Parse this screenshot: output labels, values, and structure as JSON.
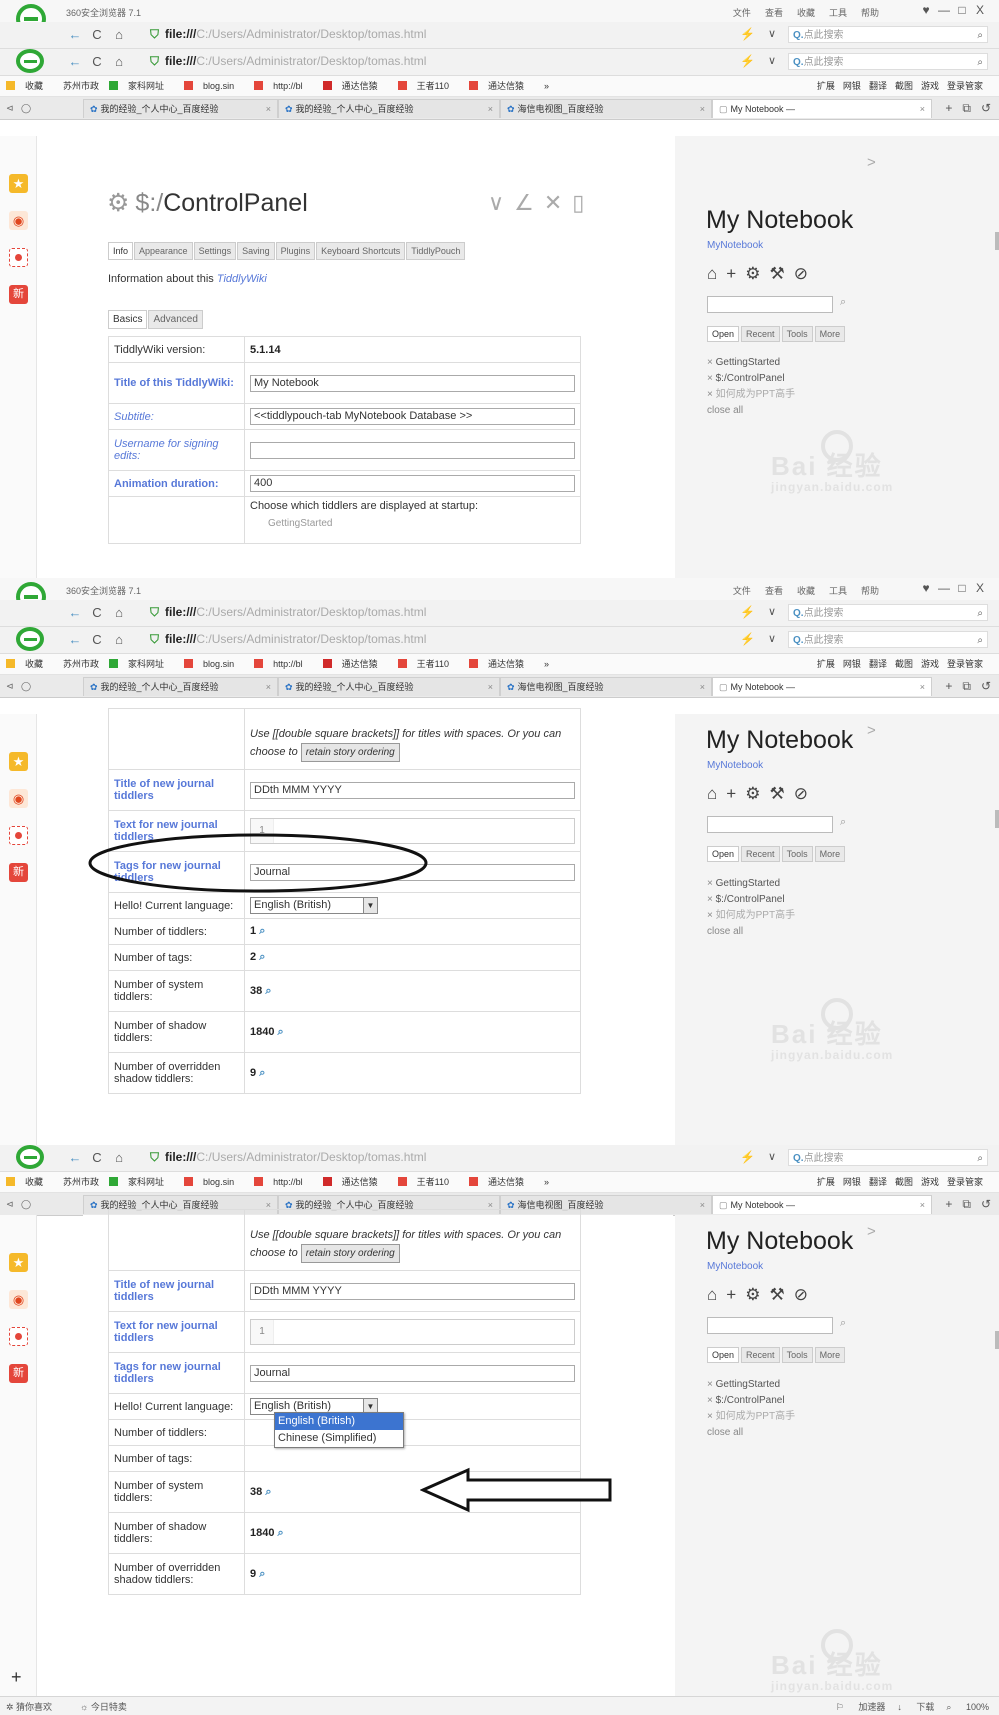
{
  "browser": {
    "app_title": "360安全浏览器 7.1",
    "menus": [
      "文件",
      "查看",
      "收藏",
      "工具",
      "帮助"
    ],
    "window_controls": [
      "♥",
      "—",
      "□",
      "X"
    ],
    "address_scheme": "file:///",
    "address_path": "C:/Users/Administrator/Desktop/tomas.html",
    "search_placeholder": "点此搜索",
    "bookmarks": [
      "收藏",
      "苏州市政",
      "家科网址",
      "blog.sin",
      "http://bl",
      "通达信猿",
      "王者110",
      "通达信猿",
      "»"
    ],
    "bookmarks_right": [
      "扩展",
      "网银",
      "翻译",
      "截图",
      "游戏",
      "登录管家"
    ],
    "tabs": [
      {
        "label": "我的经验_个人中心_百度经验"
      },
      {
        "label": "我的经验_个人中心_百度经验"
      },
      {
        "label": "海信电视图_百度经验"
      },
      {
        "label": "My Notebook —"
      }
    ],
    "statusbar_left": [
      "猜你喜欢",
      "今日特卖"
    ],
    "statusbar_right": [
      "加速器",
      "下载",
      "100%"
    ]
  },
  "tiddly": {
    "cp_prefix": "$:/",
    "cp_title": "ControlPanel",
    "tabs": [
      "Info",
      "Appearance",
      "Settings",
      "Saving",
      "Plugins",
      "Keyboard Shortcuts",
      "TiddlyPouch"
    ],
    "info_text": "Information about this ",
    "info_link": "TiddlyWiki",
    "subtabs": [
      "Basics",
      "Advanced"
    ],
    "version_label": "TiddlyWiki version:",
    "version_value": "5.1.14",
    "title_label": "Title of this TiddlyWiki:",
    "title_value": "My Notebook",
    "subtitle_label": "Subtitle:",
    "subtitle_value": "<<tiddlypouch-tab MyNotebook Database >>",
    "username_label": "Username for signing edits:",
    "anim_label": "Animation duration:",
    "anim_value": "400",
    "startup_text": "Choose which tiddlers are displayed at startup:",
    "startup_item": "GettingStarted",
    "help_text": "Use [[double square brackets]] for titles with spaces. Or you can choose to ",
    "retain_button": "retain story ordering",
    "journal_title_label": "Title of new journal tiddlers",
    "journal_title_value": "DDth MMM YYYY",
    "journal_text_label": "Text for new journal tiddlers",
    "stepper_value": "1",
    "journal_tags_label": "Tags for new journal tiddlers",
    "journal_tags_value": "Journal",
    "language_label": "Hello! Current language:",
    "language_value": "English (British)",
    "language_options": [
      "English (British)",
      "Chinese (Simplified)"
    ],
    "tiddlers_label": "Number of tiddlers:",
    "tiddlers_value": "1",
    "tags_label": "Number of tags:",
    "tags_value": "2",
    "system_label": "Number of system tiddlers:",
    "system_value": "38",
    "shadow_label": "Number of shadow tiddlers:",
    "shadow_value": "1840",
    "overridden_label": "Number of overridden shadow tiddlers:",
    "overridden_value": "9"
  },
  "right_sidebar": {
    "title": "My Notebook",
    "subtitle": "MyNotebook",
    "tabs": [
      "Open",
      "Recent",
      "Tools",
      "More"
    ],
    "open_items": [
      "GettingStarted",
      "$:/ControlPanel",
      "如何成为PPT高手"
    ],
    "close_all": "close all",
    "watermark": "Bai 经验",
    "watermark_sub": "jingyan.baidu.com"
  },
  "icons": {
    "shield": "shield-icon",
    "gear": "gear-icon",
    "search": "search-icon"
  },
  "colors": {
    "link_blue": "#5778d8",
    "browser_green": "#2fa836",
    "dropdown_highlight": "#3c74d0"
  }
}
